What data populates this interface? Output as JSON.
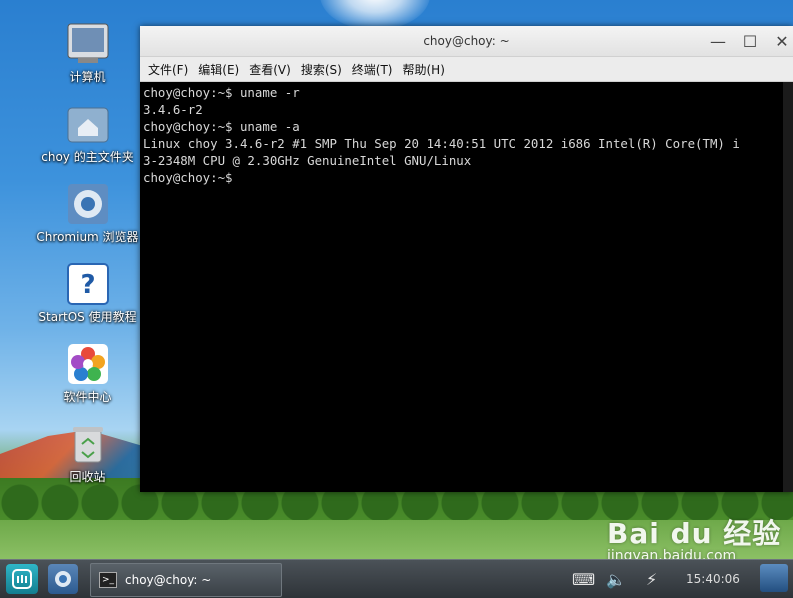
{
  "desktop": {
    "icons": [
      {
        "label": "计算机"
      },
      {
        "label": "choy 的主文件夹"
      },
      {
        "label": "Chromium 浏览器"
      },
      {
        "label": "StartOS 使用教程"
      },
      {
        "label": "软件中心"
      },
      {
        "label": "回收站"
      }
    ]
  },
  "window": {
    "title": "choy@choy: ~",
    "controls": {
      "minimize": "—",
      "maximize": "☐",
      "close": "✕"
    },
    "menu": [
      "文件(F)",
      "编辑(E)",
      "查看(V)",
      "搜索(S)",
      "终端(T)",
      "帮助(H)"
    ]
  },
  "terminal": {
    "lines": [
      "choy@choy:~$ uname -r",
      "3.4.6-r2",
      "choy@choy:~$ uname -a",
      "Linux choy 3.4.6-r2 #1 SMP Thu Sep 20 14:40:51 UTC 2012 i686 Intel(R) Core(TM) i",
      "3-2348M CPU @ 2.30GHz GenuineIntel GNU/Linux",
      "choy@choy:~$"
    ]
  },
  "watermark": {
    "brand": "Bai du 经验",
    "url": "jingyan.baidu.com"
  },
  "taskbar": {
    "task_label": "choy@choy: ~",
    "clock": "15:40:06"
  },
  "colors": {
    "terminal_bg": "#000000",
    "terminal_fg": "#d8d8d8",
    "taskbar": "#3a4046"
  }
}
